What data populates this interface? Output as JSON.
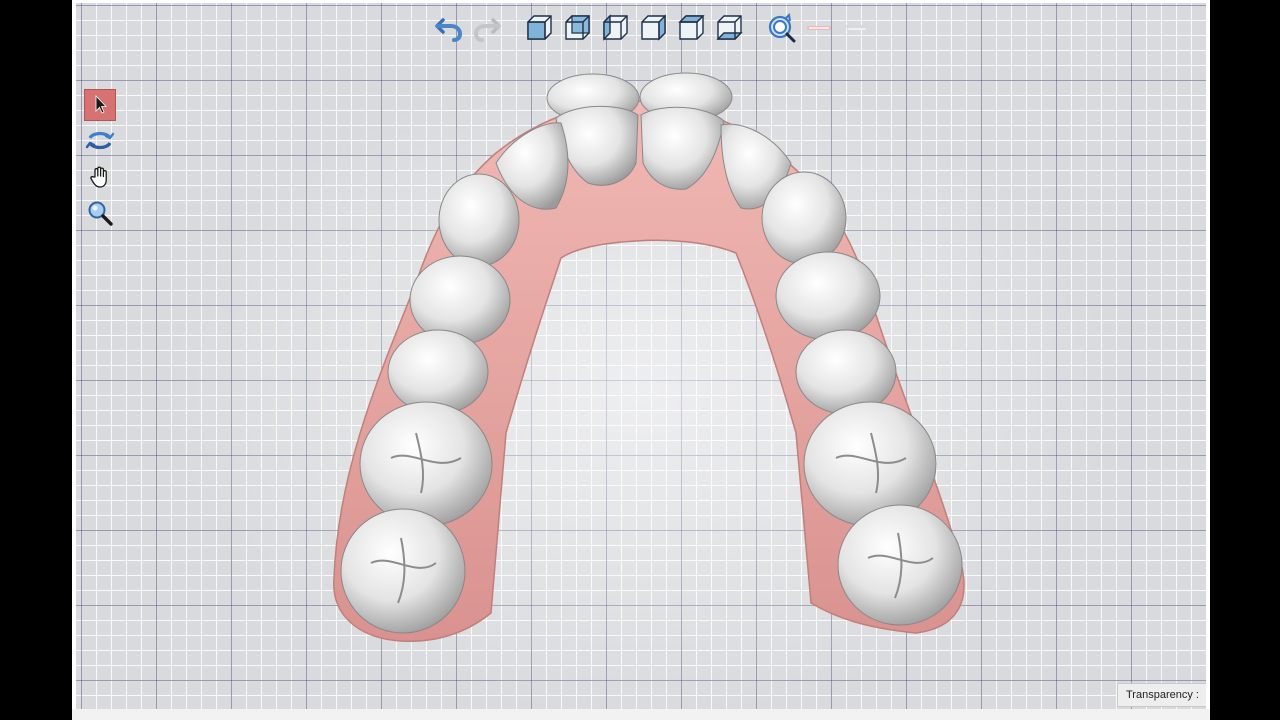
{
  "toolbar": {
    "undo_icon": "undo-arrow-icon",
    "redo_icon": "redo-arrow-icon",
    "views": [
      "view-front-icon",
      "view-back-icon",
      "view-left-icon",
      "view-right-icon",
      "view-top-icon",
      "view-bottom-icon"
    ],
    "reset_view_icon": "reset-view-icon"
  },
  "left_toolbar": {
    "tools": [
      "select-arrow-icon",
      "rotate-icon",
      "pan-hand-icon",
      "zoom-magnifier-icon"
    ],
    "active_tool": "select-arrow-icon"
  },
  "colors": {
    "grid_background": "#d9dadd",
    "grid_major": "#484a78",
    "gum": "#e7a3a0",
    "tooth": "#eeeeee",
    "active_tool": "#d67272",
    "accent_blue": "#4a86c8"
  },
  "transparency": {
    "label": "Transparency :"
  }
}
